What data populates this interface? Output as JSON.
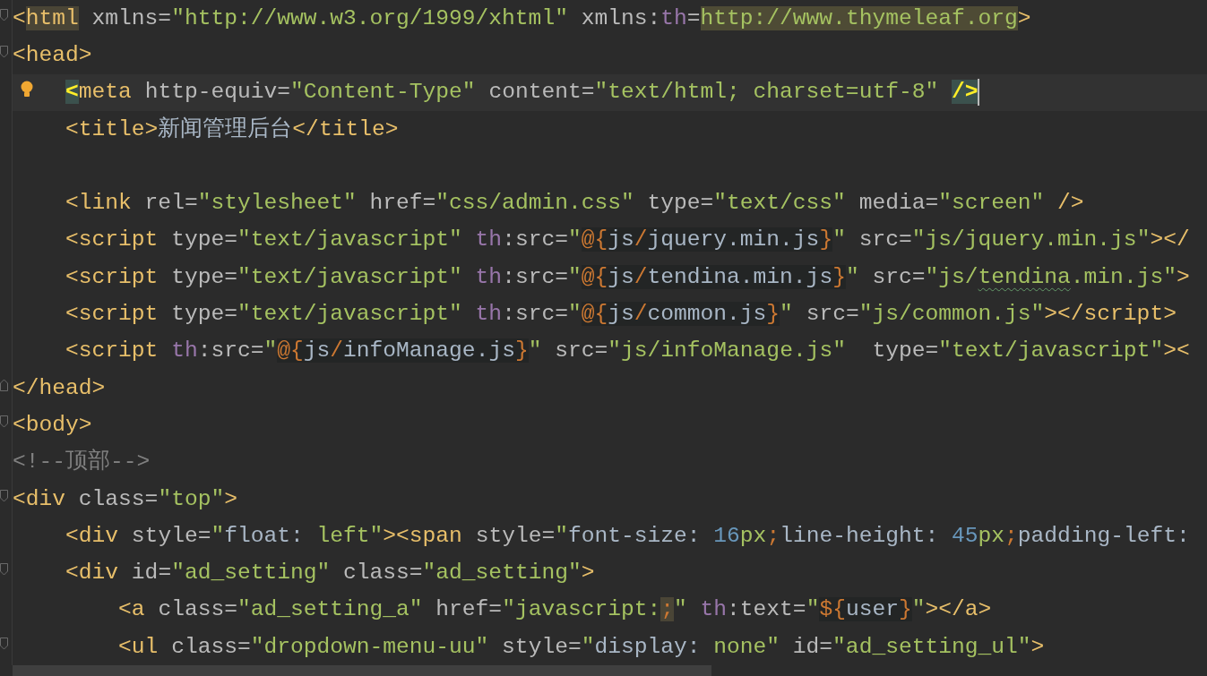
{
  "editor": {
    "lines": [
      {
        "current": false,
        "kind": "foldstart",
        "tokens": [
          {
            "text": "<",
            "kind": "tag"
          },
          {
            "text": "html",
            "kind": "tagmark"
          },
          {
            "text": " xmlns=",
            "kind": "attr"
          },
          {
            "text": "\"http://www.w3.org/1999/xhtml\"",
            "kind": "str"
          },
          {
            "text": " xmlns:",
            "kind": "attr"
          },
          {
            "text": "th",
            "kind": "ns"
          },
          {
            "text": "=",
            "kind": "attr"
          },
          {
            "text": "http://www.thymeleaf.org",
            "kind": "url"
          },
          {
            "text": ">",
            "kind": "tag"
          }
        ]
      },
      {
        "current": false,
        "kind": "foldstart",
        "tokens": [
          {
            "text": "<head>",
            "kind": "tag"
          }
        ]
      },
      {
        "current": true,
        "kind": "bulb",
        "tokens": [
          {
            "text": "    <",
            "kind": "match"
          },
          {
            "text": "meta",
            "kind": "tag"
          },
          {
            "text": " http-equiv=",
            "kind": "attr"
          },
          {
            "text": "\"Content-Type\"",
            "kind": "str"
          },
          {
            "text": " content=",
            "kind": "attr"
          },
          {
            "text": "\"text/html; charset=utf-8\"",
            "kind": "str"
          },
          {
            "text": " />",
            "kind": "match"
          }
        ]
      },
      {
        "current": false,
        "kind": "plain",
        "tokens": [
          {
            "text": "    <title>",
            "kind": "tag"
          },
          {
            "text": "新闻管理后台",
            "kind": "text"
          },
          {
            "text": "</title>",
            "kind": "tag"
          }
        ]
      },
      {
        "current": false,
        "kind": "plain"
      },
      {
        "current": false,
        "kind": "plain",
        "tokens": [
          {
            "text": "    <link",
            "kind": "tag"
          },
          {
            "text": " rel=",
            "kind": "attr"
          },
          {
            "text": "\"stylesheet\"",
            "kind": "str"
          },
          {
            "text": " href=",
            "kind": "attr"
          },
          {
            "text": "\"css/admin.css\"",
            "kind": "str"
          },
          {
            "text": " type=",
            "kind": "attr"
          },
          {
            "text": "\"text/css\"",
            "kind": "str"
          },
          {
            "text": " media=",
            "kind": "attr"
          },
          {
            "text": "\"screen\"",
            "kind": "str"
          },
          {
            "text": " />",
            "kind": "tag"
          }
        ]
      },
      {
        "current": false,
        "kind": "plain",
        "tokens": [
          {
            "text": "    <script",
            "kind": "tag"
          },
          {
            "text": " type=",
            "kind": "attr"
          },
          {
            "text": "\"text/javascript\"",
            "kind": "str"
          },
          {
            "text": " th",
            "kind": "ns"
          },
          {
            "text": ":src=",
            "kind": "attr"
          },
          {
            "text": "\"",
            "kind": "str"
          },
          {
            "text": "@{",
            "kind": "exprop"
          },
          {
            "text": "js",
            "kind": "expr"
          },
          {
            "text": "/",
            "kind": "exprop"
          },
          {
            "text": "jquery.min.js",
            "kind": "expr"
          },
          {
            "text": "}",
            "kind": "exprop"
          },
          {
            "text": "\"",
            "kind": "str"
          },
          {
            "text": " src=",
            "kind": "attr"
          },
          {
            "text": "\"js/jquery.min.js\"",
            "kind": "str"
          },
          {
            "text": "></",
            "kind": "tag"
          }
        ]
      },
      {
        "current": false,
        "kind": "plain",
        "tokens": [
          {
            "text": "    <script",
            "kind": "tag"
          },
          {
            "text": " type=",
            "kind": "attr"
          },
          {
            "text": "\"text/javascript\"",
            "kind": "str"
          },
          {
            "text": " th",
            "kind": "ns"
          },
          {
            "text": ":src=",
            "kind": "attr"
          },
          {
            "text": "\"",
            "kind": "str"
          },
          {
            "text": "@{",
            "kind": "exprop"
          },
          {
            "text": "js",
            "kind": "expr"
          },
          {
            "text": "/",
            "kind": "exprop"
          },
          {
            "text": "tendina.min.js",
            "kind": "expr"
          },
          {
            "text": "}",
            "kind": "exprop"
          },
          {
            "text": "\"",
            "kind": "str"
          },
          {
            "text": " src=",
            "kind": "attr"
          },
          {
            "text": "\"js/",
            "kind": "str"
          },
          {
            "text": "tendina",
            "kind": "typo"
          },
          {
            "text": ".min.js\"",
            "kind": "str"
          },
          {
            "text": ">",
            "kind": "tag"
          }
        ]
      },
      {
        "current": false,
        "kind": "plain",
        "tokens": [
          {
            "text": "    <script",
            "kind": "tag"
          },
          {
            "text": " type=",
            "kind": "attr"
          },
          {
            "text": "\"text/javascript\"",
            "kind": "str"
          },
          {
            "text": " th",
            "kind": "ns"
          },
          {
            "text": ":src=",
            "kind": "attr"
          },
          {
            "text": "\"",
            "kind": "str"
          },
          {
            "text": "@{",
            "kind": "exprop"
          },
          {
            "text": "js",
            "kind": "expr"
          },
          {
            "text": "/",
            "kind": "exprop"
          },
          {
            "text": "common.js",
            "kind": "expr"
          },
          {
            "text": "}",
            "kind": "exprop"
          },
          {
            "text": "\"",
            "kind": "str"
          },
          {
            "text": " src=",
            "kind": "attr"
          },
          {
            "text": "\"js/common.js\"",
            "kind": "str"
          },
          {
            "text": "></script>",
            "kind": "tag"
          }
        ]
      },
      {
        "current": false,
        "kind": "plain",
        "tokens": [
          {
            "text": "    <script",
            "kind": "tag"
          },
          {
            "text": " th",
            "kind": "ns"
          },
          {
            "text": ":src=",
            "kind": "attr"
          },
          {
            "text": "\"",
            "kind": "str"
          },
          {
            "text": "@{",
            "kind": "exprop"
          },
          {
            "text": "js",
            "kind": "expr"
          },
          {
            "text": "/",
            "kind": "exprop"
          },
          {
            "text": "infoManage.js",
            "kind": "expr"
          },
          {
            "text": "}",
            "kind": "exprop"
          },
          {
            "text": "\"",
            "kind": "str"
          },
          {
            "text": " src=",
            "kind": "attr"
          },
          {
            "text": "\"js/infoManage.js\"",
            "kind": "str"
          },
          {
            "text": "  type=",
            "kind": "attr"
          },
          {
            "text": "\"text/javascript\"",
            "kind": "str"
          },
          {
            "text": "><",
            "kind": "tag"
          }
        ]
      },
      {
        "current": false,
        "kind": "foldend",
        "tokens": [
          {
            "text": "</head>",
            "kind": "tag"
          }
        ]
      },
      {
        "current": false,
        "kind": "foldstart",
        "tokens": [
          {
            "text": "<body>",
            "kind": "tag"
          }
        ]
      },
      {
        "current": false,
        "kind": "plain",
        "tokens": [
          {
            "text": "<!--顶部-->",
            "kind": "comment"
          }
        ]
      },
      {
        "current": false,
        "kind": "foldstart",
        "tokens": [
          {
            "text": "<div",
            "kind": "tag"
          },
          {
            "text": " class=",
            "kind": "attr"
          },
          {
            "text": "\"top\"",
            "kind": "str"
          },
          {
            "text": ">",
            "kind": "tag"
          }
        ]
      },
      {
        "current": false,
        "kind": "plain",
        "tokens": [
          {
            "text": "    <div",
            "kind": "tag"
          },
          {
            "text": " style=",
            "kind": "attr"
          },
          {
            "text": "\"",
            "kind": "str"
          },
          {
            "text": "float: ",
            "kind": "text"
          },
          {
            "text": "left\"",
            "kind": "str"
          },
          {
            "text": "><span",
            "kind": "tag"
          },
          {
            "text": " style=",
            "kind": "attr"
          },
          {
            "text": "\"",
            "kind": "str"
          },
          {
            "text": "font-size: ",
            "kind": "text"
          },
          {
            "text": "16",
            "kind": "num"
          },
          {
            "text": "px",
            "kind": "str"
          },
          {
            "text": ";",
            "kind": "op"
          },
          {
            "text": "line-height: ",
            "kind": "text"
          },
          {
            "text": "45",
            "kind": "num"
          },
          {
            "text": "px",
            "kind": "str"
          },
          {
            "text": ";",
            "kind": "op"
          },
          {
            "text": "padding-left:",
            "kind": "text"
          }
        ]
      },
      {
        "current": false,
        "kind": "foldstart",
        "tokens": [
          {
            "text": "    <div",
            "kind": "tag"
          },
          {
            "text": " id=",
            "kind": "attr"
          },
          {
            "text": "\"ad_setting\"",
            "kind": "str"
          },
          {
            "text": " class=",
            "kind": "attr"
          },
          {
            "text": "\"ad_setting\"",
            "kind": "str"
          },
          {
            "text": ">",
            "kind": "tag"
          }
        ]
      },
      {
        "current": false,
        "kind": "plain",
        "tokens": [
          {
            "text": "        <a",
            "kind": "tag"
          },
          {
            "text": " class=",
            "kind": "attr"
          },
          {
            "text": "\"ad_setting_a\"",
            "kind": "str"
          },
          {
            "text": " href=",
            "kind": "attr"
          },
          {
            "text": "\"javascript:",
            "kind": "str"
          },
          {
            "text": ";",
            "kind": "semi"
          },
          {
            "text": "\"",
            "kind": "str"
          },
          {
            "text": " th",
            "kind": "ns"
          },
          {
            "text": ":text=",
            "kind": "attr"
          },
          {
            "text": "\"",
            "kind": "str"
          },
          {
            "text": "${",
            "kind": "exprop"
          },
          {
            "text": "user",
            "kind": "expr"
          },
          {
            "text": "}",
            "kind": "exprop"
          },
          {
            "text": "\"",
            "kind": "str"
          },
          {
            "text": "></a>",
            "kind": "tag"
          }
        ]
      },
      {
        "current": false,
        "kind": "foldstart",
        "tokens": [
          {
            "text": "        <ul",
            "kind": "tag"
          },
          {
            "text": " class=",
            "kind": "attr"
          },
          {
            "text": "\"dropdown-menu-uu\"",
            "kind": "str"
          },
          {
            "text": " style=",
            "kind": "attr"
          },
          {
            "text": "\"",
            "kind": "str"
          },
          {
            "text": "display: ",
            "kind": "text"
          },
          {
            "text": "none\"",
            "kind": "str"
          },
          {
            "text": " id=",
            "kind": "attr"
          },
          {
            "text": "\"ad_setting_ul\"",
            "kind": "str"
          },
          {
            "text": ">",
            "kind": "tag"
          }
        ]
      }
    ]
  }
}
